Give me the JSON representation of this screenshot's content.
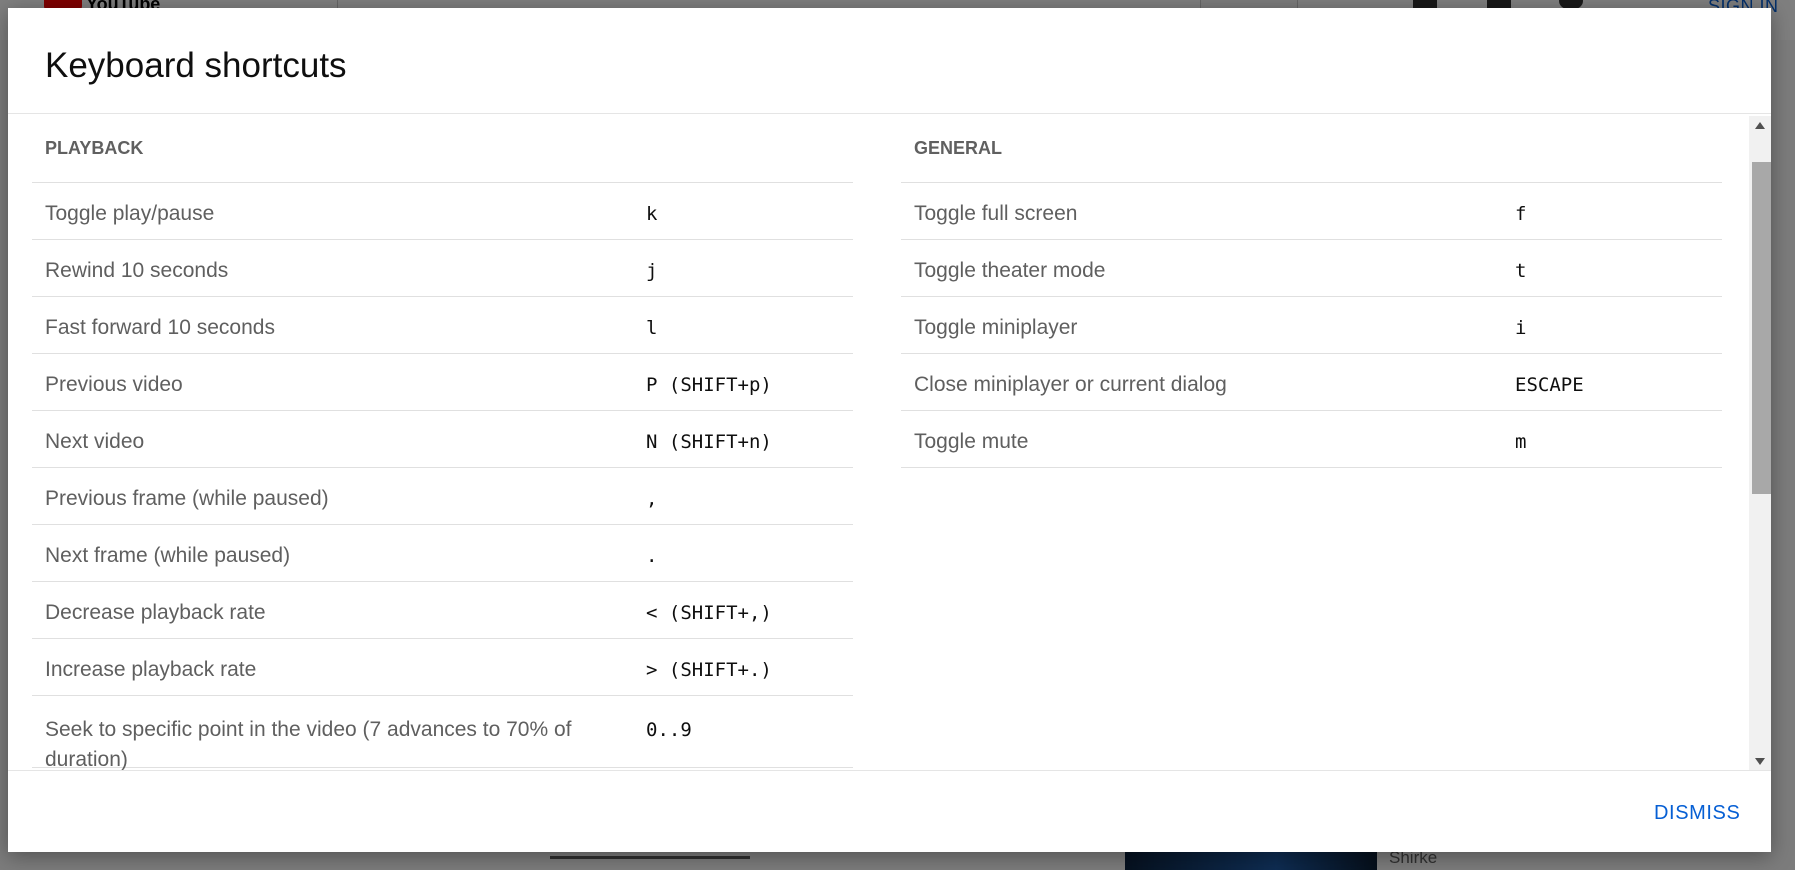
{
  "background": {
    "logo_text": "YouTube",
    "signin_label": "SIGN IN",
    "side_text": "Shirke"
  },
  "dialog": {
    "title": "Keyboard shortcuts",
    "dismiss_label": "DISMISS",
    "sections": {
      "playback": {
        "header": "PLAYBACK",
        "rows": [
          {
            "label": "Toggle play/pause",
            "key": "k"
          },
          {
            "label": "Rewind 10 seconds",
            "key": "j"
          },
          {
            "label": "Fast forward 10 seconds",
            "key": "l"
          },
          {
            "label": "Previous video",
            "key": "P (SHIFT+p)"
          },
          {
            "label": "Next video",
            "key": "N (SHIFT+n)"
          },
          {
            "label": "Previous frame (while paused)",
            "key": ","
          },
          {
            "label": "Next frame (while paused)",
            "key": "."
          },
          {
            "label": "Decrease playback rate",
            "key": "< (SHIFT+,)"
          },
          {
            "label": "Increase playback rate",
            "key": "> (SHIFT+.)"
          },
          {
            "label": "Seek to specific point in the video (7 advances to 70% of duration)",
            "key": "0..9"
          }
        ]
      },
      "general": {
        "header": "GENERAL",
        "rows": [
          {
            "label": "Toggle full screen",
            "key": "f"
          },
          {
            "label": "Toggle theater mode",
            "key": "t"
          },
          {
            "label": "Toggle miniplayer",
            "key": "i"
          },
          {
            "label": "Close miniplayer or current dialog",
            "key": "ESCAPE"
          },
          {
            "label": "Toggle mute",
            "key": "m"
          }
        ]
      }
    }
  },
  "colors": {
    "accent": "#065fd4",
    "title_text": "#0f0f0f",
    "label_text": "#5f5f5f",
    "divider": "#e0e0e0"
  },
  "icons": {
    "scroll_up": "triangle-up-icon",
    "scroll_down": "triangle-down-icon"
  }
}
